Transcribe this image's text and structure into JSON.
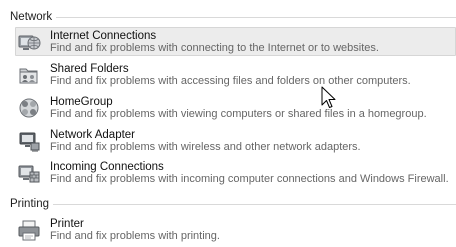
{
  "sections": [
    {
      "title": "Network",
      "items": [
        {
          "icon": "internet-connections-icon",
          "title": "Internet Connections",
          "desc": "Find and fix problems with connecting to the Internet or to websites."
        },
        {
          "icon": "shared-folders-icon",
          "title": "Shared Folders",
          "desc": "Find and fix problems with accessing files and folders on other computers."
        },
        {
          "icon": "homegroup-icon",
          "title": "HomeGroup",
          "desc": "Find and fix problems with viewing computers or shared files in a homegroup."
        },
        {
          "icon": "network-adapter-icon",
          "title": "Network Adapter",
          "desc": "Find and fix problems with wireless and other network adapters."
        },
        {
          "icon": "incoming-connections-icon",
          "title": "Incoming Connections",
          "desc": "Find and fix problems with incoming computer connections and Windows Firewall."
        }
      ]
    },
    {
      "title": "Printing",
      "items": [
        {
          "icon": "printer-icon",
          "title": "Printer",
          "desc": "Find and fix problems with printing."
        }
      ]
    }
  ],
  "selected_item": "Internet Connections"
}
